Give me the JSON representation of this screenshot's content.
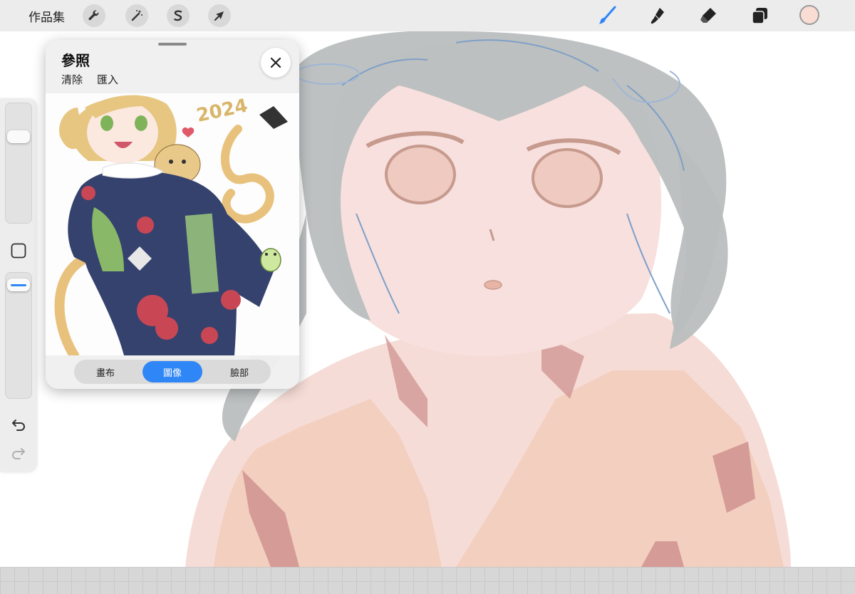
{
  "toolbar": {
    "gallery_label": "作品集",
    "left_tools": [
      "wrench-icon",
      "magic-wand-icon",
      "selection-icon",
      "transform-arrow-icon"
    ],
    "right_tools": [
      "brush-icon",
      "smudge-icon",
      "eraser-icon",
      "layers-icon"
    ],
    "active_tool": "brush-icon",
    "current_color": "#f9dcd4",
    "accent_color": "#2f86f6"
  },
  "sidebar": {
    "brush_size_level": 0.2,
    "opacity_level": 0.95,
    "buttons": [
      "modify-button",
      "undo-icon",
      "redo-icon"
    ]
  },
  "reference": {
    "title": "參照",
    "actions": [
      "清除",
      "匯入"
    ],
    "tabs": [
      "畫布",
      "圖像",
      "臉部"
    ],
    "active_tab": "圖像",
    "image_text": "2024"
  }
}
